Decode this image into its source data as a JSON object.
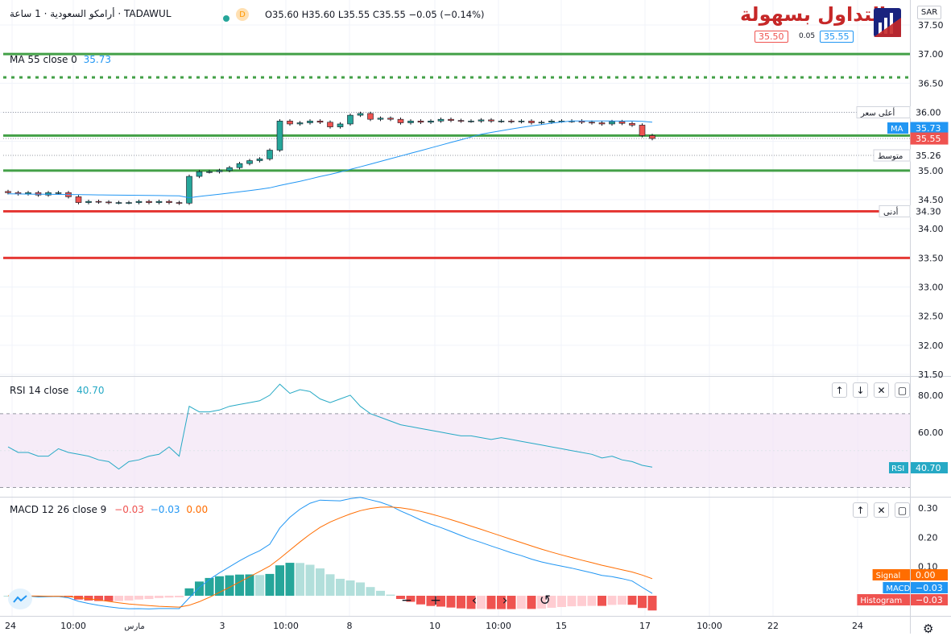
{
  "header": {
    "title": "أرامكو السعودية · 1 ساعة · TADAWUL",
    "interval_badge": "D",
    "ohlc": {
      "o": "O35.60",
      "h": "H35.60",
      "l": "L35.55",
      "c": "C35.55",
      "chg": "−0.05 (−0.14%)"
    },
    "currency": "SAR"
  },
  "logo": {
    "text": "التداول بسهولة",
    "bid": "35.50",
    "spread": "0.05",
    "ask": "35.55"
  },
  "ma_legend": {
    "label": "MA 55 close 0",
    "value": "35.73"
  },
  "price_axis": {
    "ticks": [
      "37.50",
      "37.00",
      "36.50",
      "36.00",
      "35.50",
      "35.00",
      "34.50",
      "34.00",
      "33.50",
      "33.00",
      "32.50",
      "32.00",
      "31.50"
    ],
    "tags": {
      "high": {
        "label": "أعلى سعر",
        "value": "36.00"
      },
      "ma": {
        "label": "MA",
        "value": "35.73"
      },
      "last": {
        "value": "35.55"
      },
      "avg": {
        "label": "متوسط",
        "value": "35.26"
      },
      "low": {
        "label": "أدنى",
        "value": "34.30"
      }
    }
  },
  "rsi": {
    "legend": "RSI 14 close",
    "value": "40.70",
    "axis_ticks": [
      "80.00",
      "60.00"
    ],
    "tag_label": "RSI",
    "tag_value": "40.70"
  },
  "macd": {
    "legend": "MACD 12 26 close 9",
    "v1": "−0.03",
    "v2": "−0.03",
    "v3": "0.00",
    "axis_ticks": [
      "0.30",
      "0.20",
      "0.10"
    ],
    "tags": [
      {
        "label": "Signal",
        "value": "0.00",
        "color": "#ff6d00"
      },
      {
        "label": "MACD",
        "value": "−0.03",
        "color": "#2196f3"
      },
      {
        "label": "Histogram",
        "value": "−0.03",
        "color": "#ef5350"
      }
    ]
  },
  "time_axis": [
    "24",
    "10:00",
    "مارس",
    "3",
    "10:00",
    "8",
    "10",
    "10:00",
    "15",
    "17",
    "10:00",
    "22",
    "24"
  ],
  "colors": {
    "up": "#26a69a",
    "down": "#ef5350",
    "ma": "#2196f3",
    "green_line": "#43a047",
    "red_line": "#e53935",
    "rsi_line": "#26a9c5"
  },
  "chart_data": [
    {
      "type": "candlestick",
      "title": "أرامكو السعودية · 1 ساعة · TADAWUL",
      "ylim": [
        31.5,
        37.75
      ],
      "x": [
        "24",
        "10:00",
        "مارس",
        "3",
        "10:00",
        "8",
        "10",
        "10:00",
        "15",
        "17"
      ],
      "close_series_approx": [
        34.62,
        34.6,
        34.62,
        34.58,
        34.62,
        34.62,
        34.55,
        34.45,
        34.47,
        34.46,
        34.45,
        34.45,
        34.45,
        34.47,
        34.45,
        34.47,
        34.45,
        34.44,
        34.9,
        34.98,
        34.98,
        35.0,
        35.05,
        35.12,
        35.17,
        35.2,
        35.35,
        35.85,
        35.8,
        35.82,
        35.85,
        35.83,
        35.75,
        35.8,
        35.95,
        35.98,
        35.88,
        35.9,
        35.88,
        35.82,
        35.85,
        35.83,
        35.85,
        35.88,
        35.86,
        35.85,
        35.85,
        35.87,
        35.85,
        35.85,
        35.84,
        35.85,
        35.82,
        35.83,
        35.85,
        35.85,
        35.85,
        35.83,
        35.82,
        35.8,
        35.84,
        35.81,
        35.78,
        35.6,
        35.55
      ],
      "ma55": {
        "name": "MA 55 close 0",
        "last": 35.73
      },
      "horizontal_levels": [
        37.0,
        36.6,
        35.6,
        35.0,
        34.3,
        33.5
      ],
      "tagged_levels": {
        "high": 36.0,
        "ma": 35.73,
        "last": 35.55,
        "avg": 35.26,
        "low": 34.3
      }
    },
    {
      "type": "line",
      "title": "RSI 14 close",
      "ylim": [
        25,
        90
      ],
      "band": [
        30,
        70
      ],
      "values": [
        52,
        49,
        49,
        47,
        47,
        51,
        49,
        48,
        47,
        45,
        44,
        40,
        44,
        45,
        47,
        48,
        52,
        47,
        74,
        71,
        71,
        72,
        74,
        75,
        76,
        77,
        80,
        86,
        81,
        83,
        82,
        78,
        76,
        78,
        80,
        74,
        70,
        68,
        66,
        64,
        63,
        62,
        61,
        60,
        59,
        58,
        58,
        57,
        56,
        57,
        56,
        55,
        54,
        53,
        52,
        51,
        50,
        49,
        48,
        46,
        47,
        45,
        44,
        42,
        41
      ],
      "last": 40.7
    },
    {
      "type": "line+bar",
      "title": "MACD 12 26 close 9",
      "ylim": [
        -0.05,
        0.33
      ],
      "series": [
        {
          "name": "MACD",
          "last": -0.03
        },
        {
          "name": "Signal",
          "last": 0.0
        },
        {
          "name": "Histogram",
          "last": -0.03
        }
      ]
    }
  ]
}
